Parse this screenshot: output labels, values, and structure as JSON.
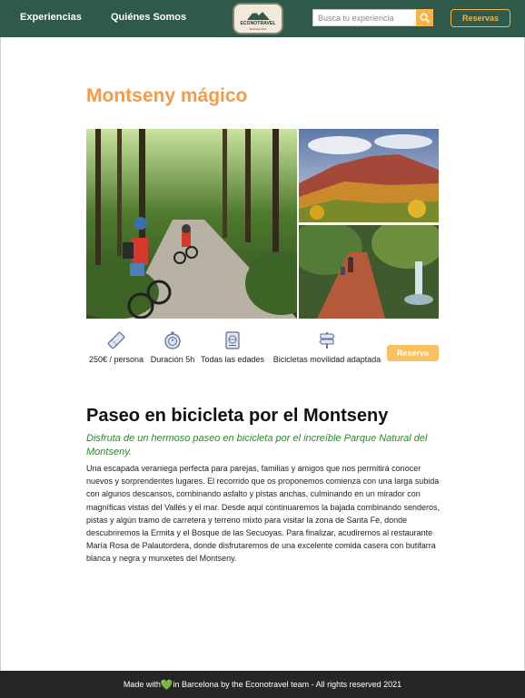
{
  "header": {
    "nav": [
      {
        "label": "Experiencias"
      },
      {
        "label": "Quiénes Somos"
      }
    ],
    "logo": {
      "text": "ECONOTRAVEL",
      "sub": "BARCELONA"
    },
    "search": {
      "placeholder": "Busca tu experiencia",
      "icon": "search-icon"
    },
    "reserve_label": "Reservas"
  },
  "colors": {
    "header_bg": "#2f5a4a",
    "accent": "#f5b44a",
    "title": "#f39b4a",
    "tagline": "#2a8a2a",
    "footer_bg": "#262626"
  },
  "main": {
    "title": "Montseny mágico",
    "features": [
      {
        "icon": "ticket-icon",
        "label": "250€ / persona"
      },
      {
        "icon": "stopwatch-icon",
        "label": "Duración 5h"
      },
      {
        "icon": "family-badge-icon",
        "label": "Todas las edades"
      },
      {
        "icon": "signpost-icon",
        "label": "Bicicletas movilidad adaptada"
      }
    ],
    "reserve_label": "Reserva",
    "subtitle": "Paseo en bicicleta por el Montseny",
    "tagline": "Disfruta de un hermoso paseo en bicicleta por el increíble Parque Natural del Montseny.",
    "description": "Una escapada veraniega perfecta para parejas, familias y amigos que nos permitirá conocer nuevos y sorprendentes lugares. El recorrido que os proponemos comienza con una larga subida con algunos descansos, combinando asfalto y pistas anchas, culminando en un mirador con magníficas vistas del Vallés y el mar. Desde aquí continuaremos la bajada combinando senderos, pistas y algún tramo de carretera y terreno mixto para visitar la zona de Santa Fe, donde descubriremos la Ermita y el Bosque de las Secuoyas. Para finalizar, acudiremos al restaurante María Rosa de Palautordera, donde disfrutaremos de una excelente comida casera con butifarra blanca y negra y munxetes del Montseny."
  },
  "footer": {
    "before": "Made with ",
    "heart": "💚",
    "after": "in Barcelona by the Econotravel team - All rights reserved 2021"
  }
}
